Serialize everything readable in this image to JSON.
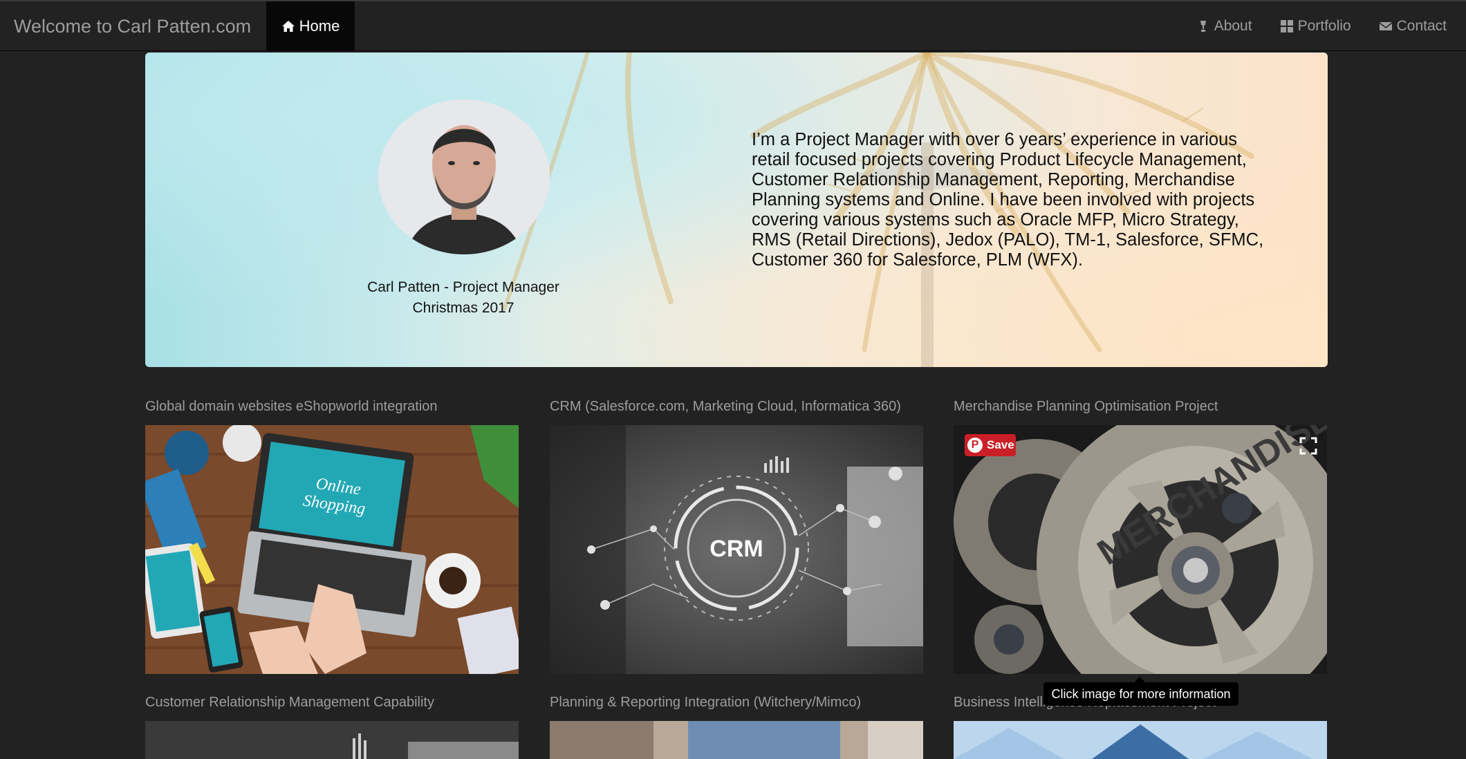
{
  "navbar": {
    "brand": "Welcome to Carl Patten.com",
    "home_label": "Home",
    "about_label": "About",
    "portfolio_label": "Portfolio",
    "contact_label": "Contact",
    "icons": {
      "home": "home-icon",
      "about": "lamp-icon",
      "portfolio": "grid-icon",
      "contact": "envelope-icon"
    }
  },
  "hero": {
    "caption_line1": "Carl Patten - Project Manager",
    "caption_line2": "Christmas 2017",
    "bio": "I’m a Project Manager with over 6 years’ experience in various retail focused projects covering Product Lifecycle Management, Customer Relationship Management, Reporting, Merchandise Planning systems and Online. I have been involved with projects covering various systems such as Oracle MFP, Micro Strategy, RMS (Retail Directions), Jedox (PALO), TM-1, Salesforce, SFMC, Customer 360 for Salesforce, PLM (WFX)."
  },
  "portfolio": {
    "row1": [
      {
        "title": "Global domain websites eShopworld integration"
      },
      {
        "title": "CRM (Salesforce.com, Marketing Cloud, Informatica 360)",
        "overlay_text": "CRM"
      },
      {
        "title": "Merchandise Planning Optimisation Project",
        "overlay_text": "MERCHANDISE"
      }
    ],
    "row2": [
      {
        "title": "Customer Relationship Management Capability"
      },
      {
        "title": "Planning & Reporting Integration (Witchery/Mimco)"
      },
      {
        "title": "Business Intelligence Replacement Project"
      }
    ],
    "save_label": "Save",
    "tooltip": "Click image for more information"
  },
  "colors": {
    "navbar_bg": "#222222",
    "nav_active_bg": "#080808",
    "nav_text": "#9d9d9d",
    "pinterest_red": "#cb1f27"
  }
}
